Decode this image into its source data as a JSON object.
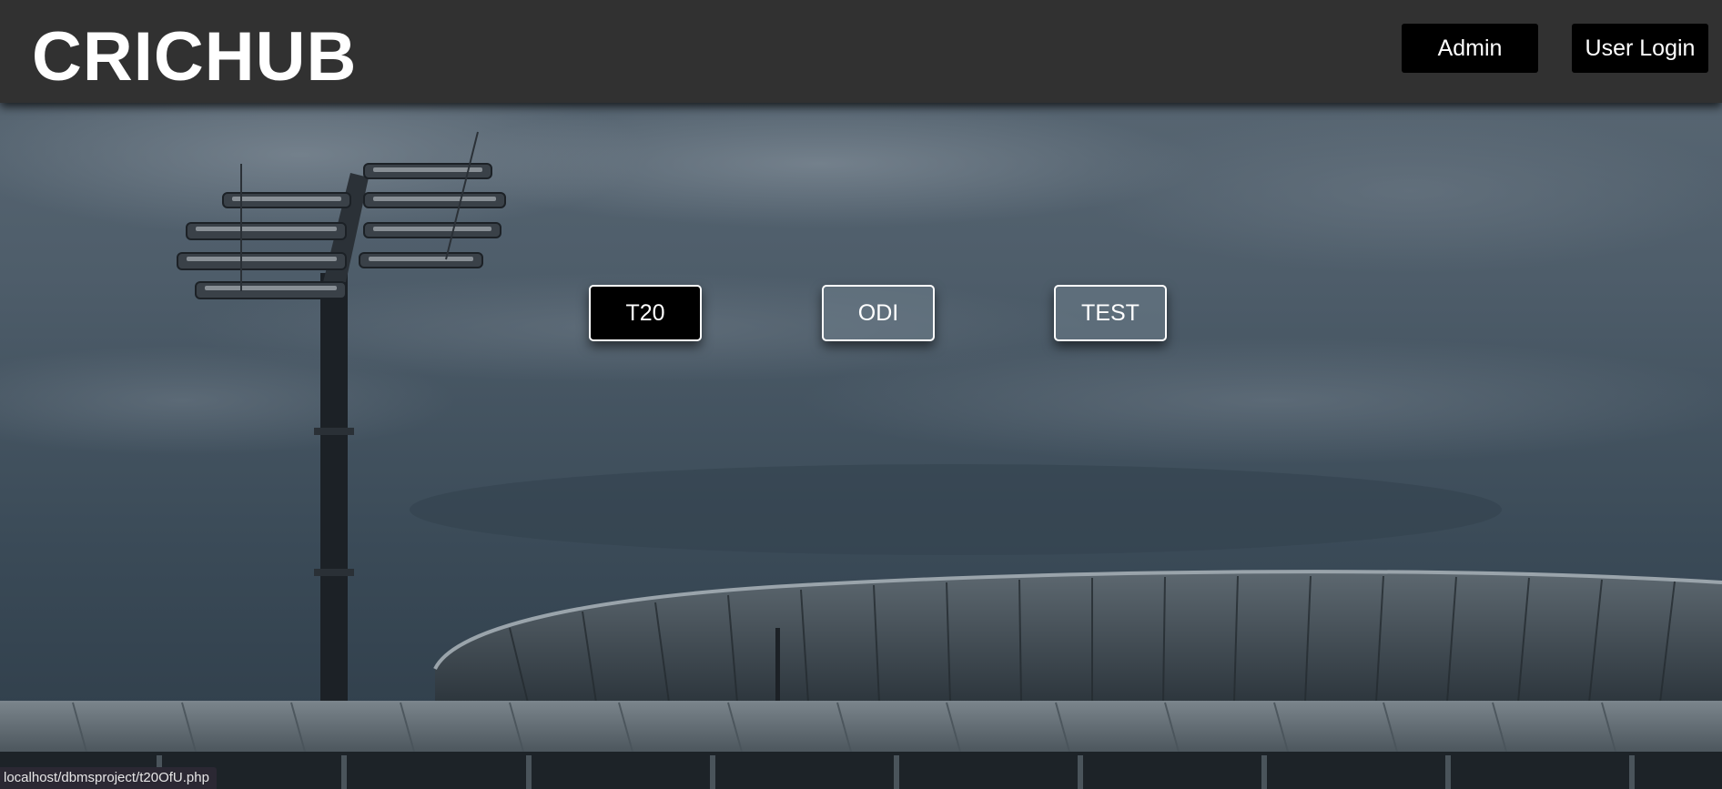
{
  "header": {
    "logo": "CRICHUB",
    "admin_label": "Admin",
    "user_login_label": "User Login"
  },
  "formats": {
    "t20_label": "T20",
    "odi_label": "ODI",
    "test_label": "TEST",
    "active": "T20"
  },
  "status_bar": {
    "url": "localhost/dbmsproject/t20OfU.php"
  }
}
